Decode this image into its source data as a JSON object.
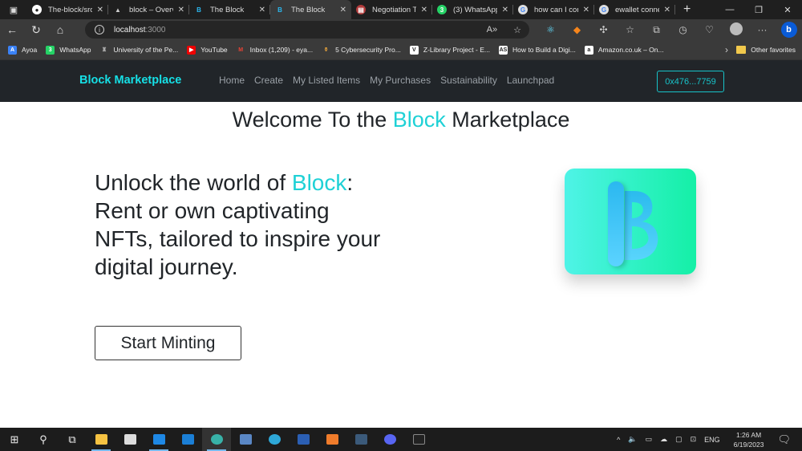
{
  "browser": {
    "tabs": [
      {
        "title": "The-block/src",
        "icon": "github-icon",
        "active": false
      },
      {
        "title": "block – Overv",
        "icon": "vercel-icon",
        "active": false
      },
      {
        "title": "The Block",
        "icon": "block-b-icon",
        "active": false
      },
      {
        "title": "The Block",
        "icon": "block-b-icon",
        "active": true
      },
      {
        "title": "Negotiation T",
        "icon": "document-icon",
        "active": false
      },
      {
        "title": "(3) WhatsApp",
        "icon": "whatsapp-icon",
        "active": false
      },
      {
        "title": "how can I cor",
        "icon": "google-icon",
        "active": false
      },
      {
        "title": "ewallet conne",
        "icon": "google-icon",
        "active": false
      }
    ],
    "new_tab_label": "+",
    "url_host": "localhost",
    "url_port": ":3000",
    "bookmarks": [
      {
        "label": "Ayoa",
        "icon": "ayoa-icon"
      },
      {
        "label": "WhatsApp",
        "icon": "whatsapp-icon"
      },
      {
        "label": "University of the Pe...",
        "icon": "university-icon"
      },
      {
        "label": "YouTube",
        "icon": "youtube-icon"
      },
      {
        "label": "Inbox (1,209) - eya...",
        "icon": "gmail-icon"
      },
      {
        "label": "5 Cybersecurity Pro...",
        "icon": "article-icon"
      },
      {
        "label": "Z-Library Project - E...",
        "icon": "zlibrary-icon"
      },
      {
        "label": "How to Build a Digi...",
        "icon": "as-icon"
      },
      {
        "label": "Amazon.co.uk – On...",
        "icon": "amazon-icon"
      }
    ],
    "other_favorites": "Other favorites"
  },
  "site": {
    "brand": "Block Marketplace",
    "nav": [
      "Home",
      "Create",
      "My Listed Items",
      "My Purchases",
      "Sustainability",
      "Launchpad"
    ],
    "wallet": "0x476...7759",
    "welcome": {
      "pre": "Welcome To the ",
      "highlight": "Block",
      "post": " Marketplace"
    },
    "hero": {
      "pre": "Unlock the world of ",
      "highlight": "Block",
      "post": ": Rent or own captivating NFTs, tailored to inspire your digital journey."
    },
    "cta": "Start Minting",
    "colors": {
      "accent": "#1fd1d6",
      "nav_bg": "#212529"
    }
  },
  "taskbar": {
    "apps": [
      "start",
      "search",
      "task-view",
      "file-explorer",
      "store",
      "vscode",
      "mail",
      "edge-profile",
      "virtualbox",
      "edge",
      "word",
      "xampp",
      "mysql-workbench",
      "discord",
      "terminal"
    ],
    "lang": "ENG",
    "time": "1:26 AM",
    "date": "6/19/2023"
  }
}
